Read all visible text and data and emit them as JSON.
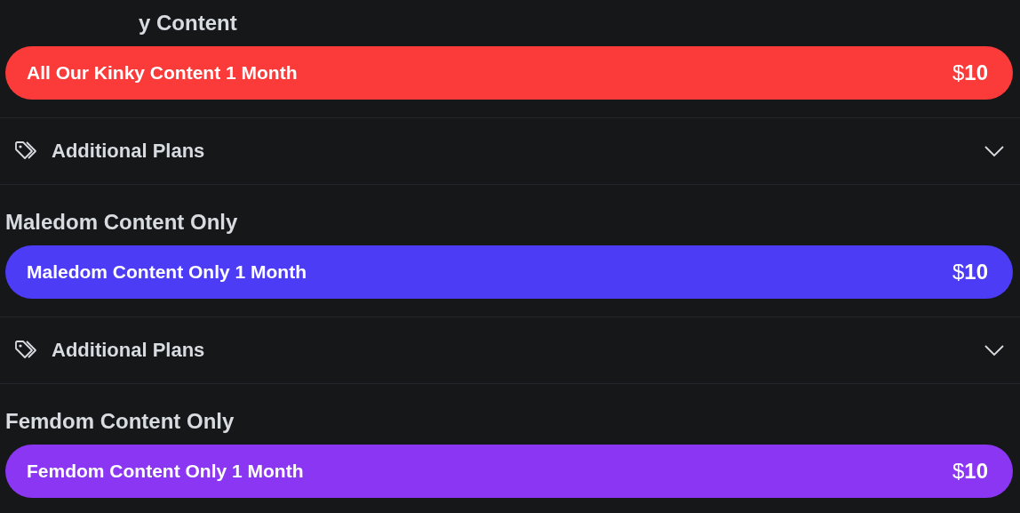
{
  "sections": [
    {
      "heading": "y Content",
      "heading_partial": true,
      "plan": {
        "label": "All Our Kinky Content 1 Month",
        "price": "$**10**",
        "color": "#fb3a3a"
      },
      "additional": {
        "label": "Additional Plans",
        "expanded": false
      }
    },
    {
      "heading": "Maledom Content Only",
      "plan": {
        "label": "Maledom Content Only 1 Month",
        "price": "$**10**",
        "color": "#4c3cf5"
      },
      "additional": {
        "label": "Additional Plans",
        "expanded": false
      }
    },
    {
      "heading": "Femdom Content Only",
      "plan": {
        "label": "Femdom Content Only 1 Month",
        "price": "$**10**",
        "color": "#8a36f2"
      }
    }
  ]
}
